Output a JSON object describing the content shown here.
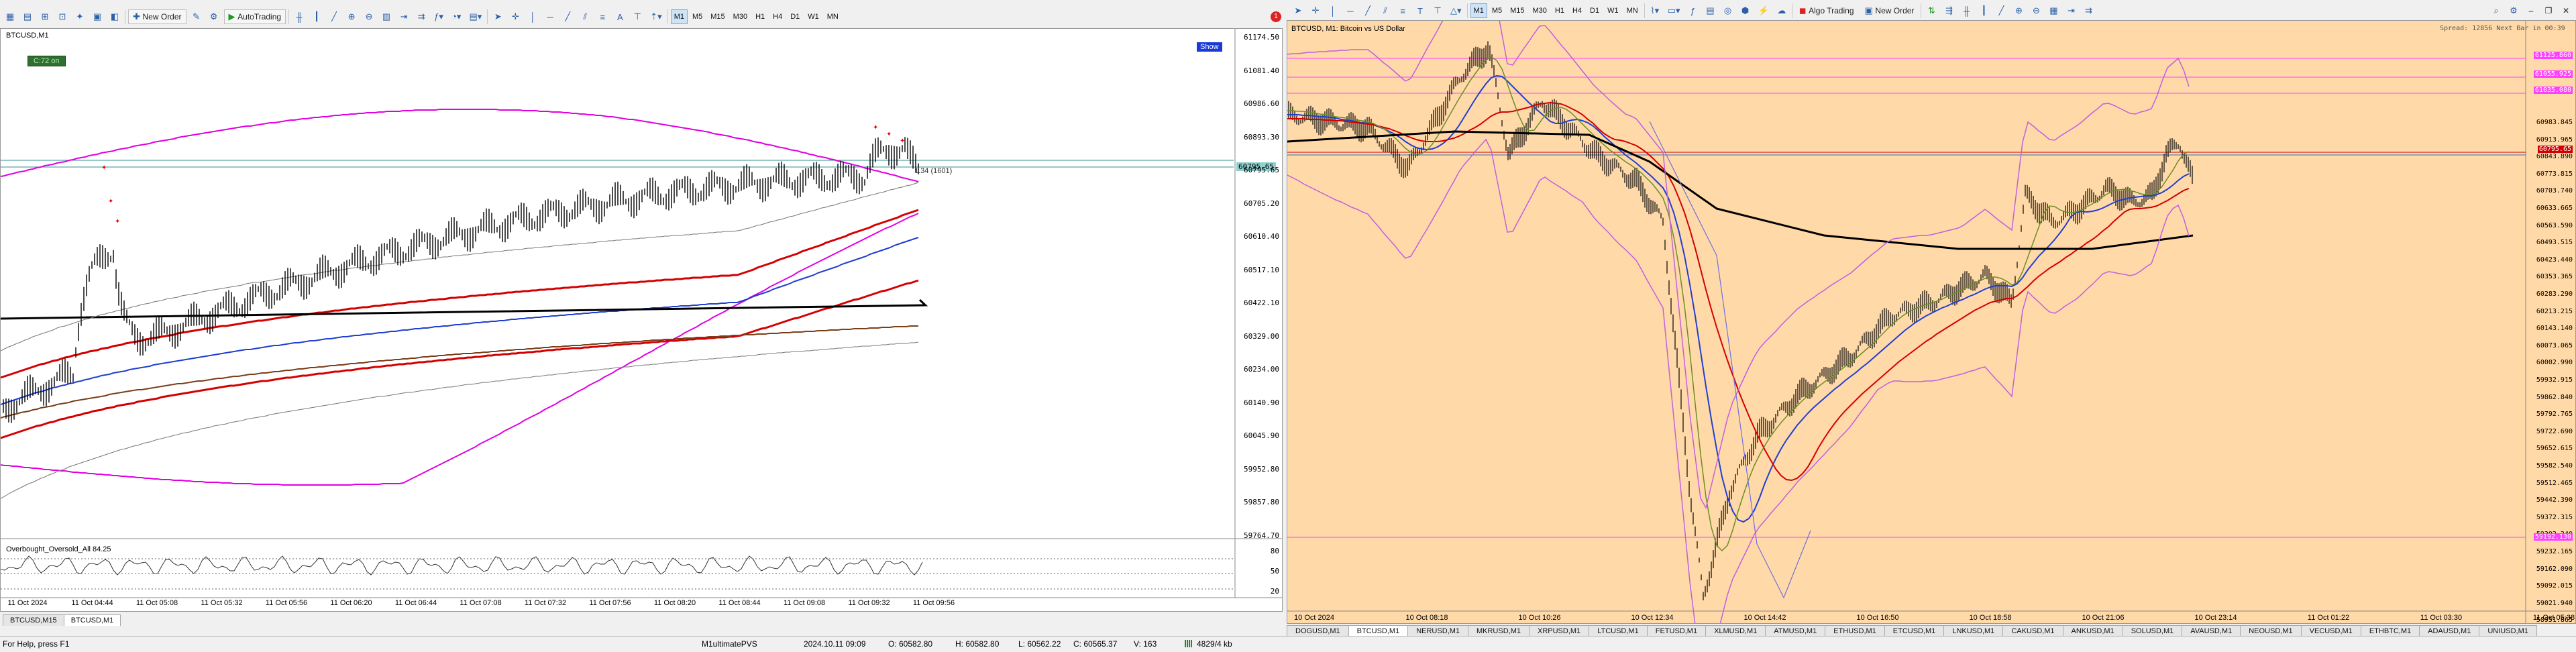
{
  "left_window": {
    "toolbar": {
      "new_order_label": "New Order",
      "autotrading_label": "AutoTrading",
      "timeframes": [
        "M1",
        "M5",
        "M15",
        "M30",
        "H1",
        "H4",
        "D1",
        "W1",
        "MN"
      ]
    },
    "chart_title": "BTCUSD,M1",
    "ea_badge": "C:72 on",
    "show_button": "Show",
    "price_box": "60795.65",
    "line_note": "1.34 (1601)",
    "y_labels": [
      "61174.50",
      "61081.40",
      "60986.60",
      "60893.30",
      "60795.65",
      "60705.20",
      "60610.40",
      "60517.10",
      "60422.10",
      "60329.00",
      "60234.00",
      "60140.90",
      "60045.90",
      "59952.80",
      "59857.80",
      "59764.70"
    ],
    "x_labels": [
      "11 Oct 2024",
      "11 Oct 04:44",
      "11 Oct 05:08",
      "11 Oct 05:32",
      "11 Oct 05:56",
      "11 Oct 06:20",
      "11 Oct 06:44",
      "11 Oct 07:08",
      "11 Oct 07:32",
      "11 Oct 07:56",
      "11 Oct 08:20",
      "11 Oct 08:44",
      "11 Oct 09:08",
      "11 Oct 09:32",
      "11 Oct 09:56"
    ],
    "indicator_title": "Overbought_Oversold_All 84.25",
    "indicator_levels": [
      "80",
      "50",
      "20"
    ],
    "tabs": [
      "BTCUSD,M15",
      "BTCUSD,M1"
    ],
    "active_tab": 1
  },
  "right_window": {
    "toolbar": {
      "timeframes": [
        "M1",
        "M5",
        "M15",
        "M30",
        "H1",
        "H4",
        "D1",
        "W1",
        "MN"
      ],
      "algo_trading_label": "Algo Trading",
      "new_order_label": "New Order"
    },
    "chart_title": "BTCUSD, M1:  Bitcoin vs US Dollar",
    "info_text": "Spread: 12856 Next Bar in 00:39",
    "y_labels": [
      "60983.845",
      "60913.965",
      "60843.890",
      "60773.815",
      "60703.740",
      "60633.665",
      "60563.590",
      "60493.515",
      "60423.440",
      "60353.365",
      "60283.290",
      "60213.215",
      "60143.140",
      "60073.065",
      "60002.990",
      "59932.915",
      "59862.840",
      "59792.765",
      "59722.690",
      "59652.615",
      "59582.540",
      "59512.465",
      "59442.390",
      "59372.315",
      "59302.240",
      "59232.165",
      "59162.090",
      "59092.015",
      "59021.940",
      "58951.865"
    ],
    "highlight_labels": [
      "61125.860",
      "61055.925",
      "61035.080",
      "60795.65",
      "59192.130"
    ],
    "x_labels": [
      "10 Oct 2024",
      "10 Oct 08:18",
      "10 Oct 10:26",
      "10 Oct 12:34",
      "10 Oct 14:42",
      "10 Oct 16:50",
      "10 Oct 18:58",
      "10 Oct 21:06",
      "10 Oct 23:14",
      "11 Oct 01:22",
      "11 Oct 03:30",
      "11 Oct 05:38"
    ],
    "symbol_tabs": [
      "DOGUSD,M1",
      "BTCUSD,M1",
      "NERUSD,M1",
      "MKRUSD,M1",
      "XRPUSD,M1",
      "LTCUSD,M1",
      "FETUSD,M1",
      "XLMUSD,M1",
      "ATMUSD,M1",
      "ETHUSD,M1",
      "ETCUSD,M1",
      "LNKUSD,M1",
      "CAKUSD,M1",
      "ANKUSD,M1",
      "SOLUSD,M1",
      "AVAUSD,M1",
      "NEOUSD,M1",
      "VECUSD,M1",
      "ETHBTC,M1",
      "ADAUSD,M1",
      "UNIUSD,M1"
    ],
    "active_tab": 1
  },
  "status_bar": {
    "help": "For Help, press F1",
    "profile": "M1ultimatePVS",
    "datetime": "2024.10.11 09:09",
    "open": "O: 60582.80",
    "high": "H: 60582.80",
    "low": "L: 60562.22",
    "close": "C: 60565.37",
    "volume": "V: 163",
    "traffic": "4829/4 kb"
  },
  "colors": {
    "bollinger": "#e000e0",
    "ma_red": "#d40000",
    "ma_blue": "#1f3fd0",
    "ma_black": "#000000",
    "right_bg": "#ffd9a8",
    "price_line": "#2f8f8f"
  }
}
